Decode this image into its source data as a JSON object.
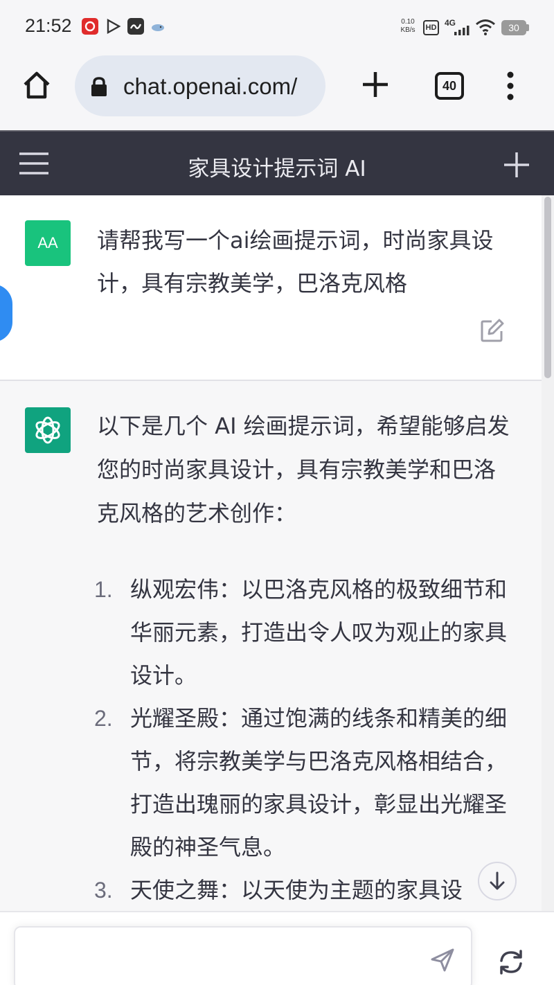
{
  "status_bar": {
    "time": "21:52",
    "net_speed_value": "0.10",
    "net_speed_unit": "KB/s",
    "hd_label": "HD",
    "network": "4G",
    "battery": "30"
  },
  "browser": {
    "url": "chat.openai.com/",
    "tab_count": "40"
  },
  "header": {
    "title": "家具设计提示词 AI"
  },
  "user_message": {
    "avatar_initials": "AA",
    "text": "请帮我写一个ai绘画提示词，时尚家具设计，具有宗教美学，巴洛克风格"
  },
  "assistant_message": {
    "intro": "以下是几个 AI 绘画提示词，希望能够启发您的时尚家具设计，具有宗教美学和巴洛克风格的艺术创作：",
    "items": [
      {
        "num": "1.",
        "text": "纵观宏伟：以巴洛克风格的极致细节和华丽元素，打造出令人叹为观止的家具设计。"
      },
      {
        "num": "2.",
        "text": "光耀圣殿：通过饱满的线条和精美的细节，将宗教美学与巴洛克风格相结合，打造出瑰丽的家具设计，彰显出光耀圣殿的神圣气息。"
      },
      {
        "num": "3.",
        "text": "天使之舞：以天使为主题的家具设"
      }
    ]
  },
  "composer": {
    "placeholder": ""
  },
  "colors": {
    "header_bg": "#343541",
    "user_avatar": "#19c37d",
    "gpt_avatar": "#10a37f",
    "url_bar_bg": "#e3e8f1"
  }
}
